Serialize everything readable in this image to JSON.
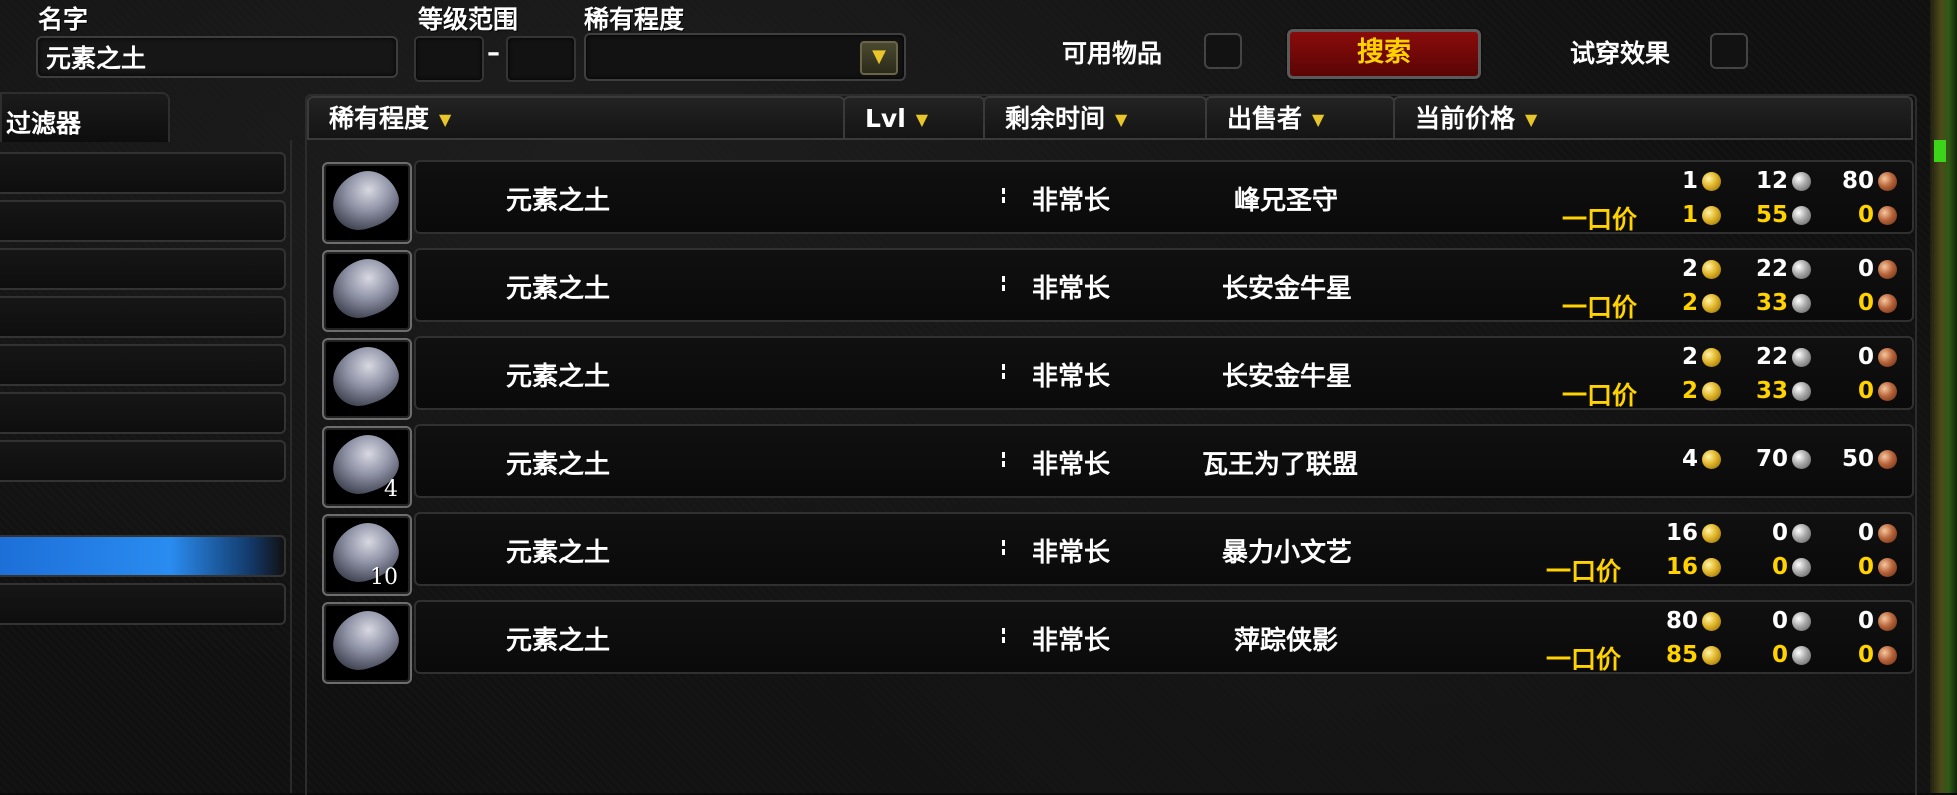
{
  "top": {
    "name_label": "名字",
    "name_value": "元素之土",
    "level_range_label": "等级范围",
    "level_dash": "–",
    "rarity_label": "稀有程度",
    "usable_label": "可用物品",
    "search_button": "搜索",
    "tryon_label": "试穿效果"
  },
  "filter": {
    "tab_label": "过滤器",
    "slot_count": 9,
    "selected_index": 8
  },
  "table": {
    "headers": [
      "稀有程度",
      "Lvl",
      "剩余时间",
      "出售者",
      "当前价格"
    ],
    "buyout_label": "一口价",
    "rows": [
      {
        "name": "元素之土",
        "stack": "",
        "time": "非常长",
        "seller": "峰兄圣守",
        "bid": {
          "g": "1",
          "s": "12",
          "c": "80"
        },
        "buyout": {
          "g": "1",
          "s": "55",
          "c": "0"
        }
      },
      {
        "name": "元素之土",
        "stack": "",
        "time": "非常长",
        "seller": "长安金牛星",
        "bid": {
          "g": "2",
          "s": "22",
          "c": "0"
        },
        "buyout": {
          "g": "2",
          "s": "33",
          "c": "0"
        }
      },
      {
        "name": "元素之土",
        "stack": "",
        "time": "非常长",
        "seller": "长安金牛星",
        "bid": {
          "g": "2",
          "s": "22",
          "c": "0"
        },
        "buyout": {
          "g": "2",
          "s": "33",
          "c": "0"
        }
      },
      {
        "name": "元素之土",
        "stack": "4",
        "time": "非常长",
        "seller": "瓦王为了联盟",
        "bid": {
          "g": "4",
          "s": "70",
          "c": "50"
        },
        "buyout": null
      },
      {
        "name": "元素之土",
        "stack": "10",
        "time": "非常长",
        "seller": "暴力小文艺",
        "bid": {
          "g": "16",
          "s": "0",
          "c": "0"
        },
        "buyout": {
          "g": "16",
          "s": "0",
          "c": "0"
        }
      },
      {
        "name": "元素之土",
        "stack": "",
        "time": "非常长",
        "seller": "萍踪侠影",
        "bid": {
          "g": "80",
          "s": "0",
          "c": "0"
        },
        "buyout": {
          "g": "85",
          "s": "0",
          "c": "0"
        }
      }
    ]
  },
  "colors": {
    "accent_gold": "#ffd200",
    "search_button_bg": "#8a0b0b",
    "filter_selected": "#2a8cf0"
  }
}
